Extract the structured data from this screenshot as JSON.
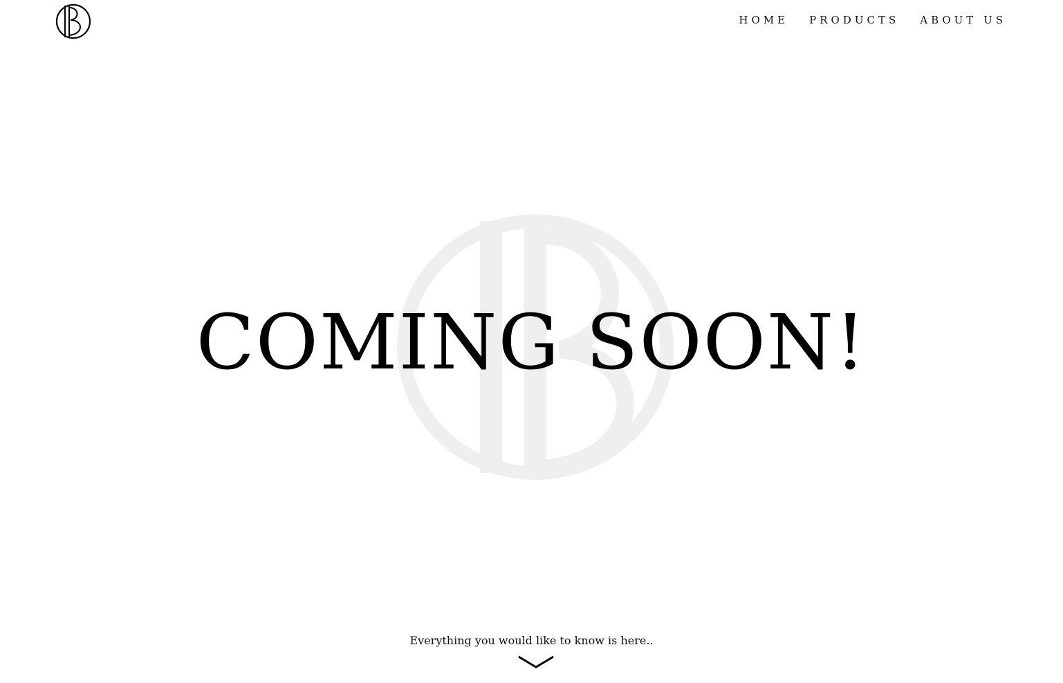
{
  "header": {
    "logo_icon": "monogram-logo-icon",
    "nav": [
      {
        "label": "HOME"
      },
      {
        "label": "PRODUCTS"
      },
      {
        "label": "ABOUT US"
      }
    ]
  },
  "hero": {
    "headline": "COMING SOON!",
    "watermark_icon": "monogram-watermark-icon"
  },
  "footer": {
    "tagline": "Everything you would like to know is here..",
    "scroll_icon": "chevron-down-icon"
  },
  "colors": {
    "background": "#ffffff",
    "text": "#000000",
    "watermark": "#efefef"
  }
}
